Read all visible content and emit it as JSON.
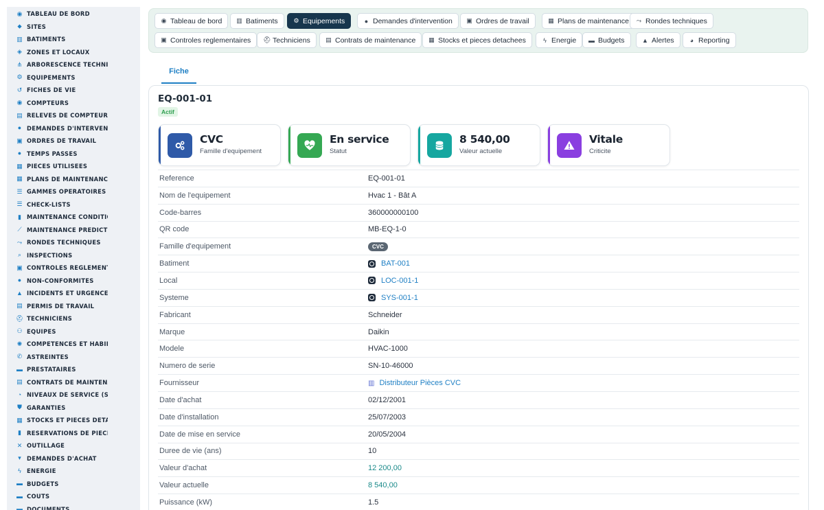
{
  "sidebar": {
    "items": [
      {
        "label": "TABLEAU DE BORD",
        "icon": "gauge-icon",
        "glyph": "◉"
      },
      {
        "label": "SITES",
        "icon": "map-pin-icon",
        "glyph": "⬥"
      },
      {
        "label": "BATIMENTS",
        "icon": "building-icon",
        "glyph": "▥"
      },
      {
        "label": "ZONES ET LOCAUX",
        "icon": "layers-icon",
        "glyph": "◈"
      },
      {
        "label": "ARBORESCENCE TECHNI",
        "icon": "tree-icon",
        "glyph": "⋔"
      },
      {
        "label": "EQUIPEMENTS",
        "icon": "gears-icon",
        "glyph": "⚙"
      },
      {
        "label": "FICHES DE VIE",
        "icon": "history-icon",
        "glyph": "↺"
      },
      {
        "label": "COMPTEURS",
        "icon": "gauge-icon",
        "glyph": "◉"
      },
      {
        "label": "RELEVES DE COMPTEURS",
        "icon": "chart-icon",
        "glyph": "▤"
      },
      {
        "label": "DEMANDES D'INTERVENT",
        "icon": "question-icon",
        "glyph": "●"
      },
      {
        "label": "ORDRES DE TRAVAIL",
        "icon": "clipboard-icon",
        "glyph": "▣"
      },
      {
        "label": "TEMPS PASSES",
        "icon": "clock-icon",
        "glyph": "●"
      },
      {
        "label": "PIECES UTILISEES",
        "icon": "boxes-icon",
        "glyph": "▦"
      },
      {
        "label": "PLANS DE MAINTENANCE",
        "icon": "calendar-icon",
        "glyph": "▦"
      },
      {
        "label": "GAMMES OPERATOIRES",
        "icon": "list-icon",
        "glyph": "☰"
      },
      {
        "label": "CHECK-LISTS",
        "icon": "checklist-icon",
        "glyph": "☰"
      },
      {
        "label": "MAINTENANCE CONDITIO",
        "icon": "thermometer-icon",
        "glyph": "▮"
      },
      {
        "label": "MAINTENANCE PREDICTI",
        "icon": "chart-line-icon",
        "glyph": "⟋"
      },
      {
        "label": "RONDES TECHNIQUES",
        "icon": "route-icon",
        "glyph": "⤳"
      },
      {
        "label": "INSPECTIONS",
        "icon": "search-icon",
        "glyph": "⌕"
      },
      {
        "label": "CONTROLES REGLEMENT",
        "icon": "clipboard-check-icon",
        "glyph": "▣"
      },
      {
        "label": "NON-CONFORMITES",
        "icon": "alert-circle-icon",
        "glyph": "●"
      },
      {
        "label": "INCIDENTS ET URGENCES",
        "icon": "warning-icon",
        "glyph": "▲"
      },
      {
        "label": "PERMIS DE TRAVAIL",
        "icon": "file-icon",
        "glyph": "▤"
      },
      {
        "label": "TECHNICIENS",
        "icon": "hard-hat-icon",
        "glyph": "⛑"
      },
      {
        "label": "EQUIPES",
        "icon": "users-icon",
        "glyph": "⚇"
      },
      {
        "label": "COMPETENCES ET HABIL",
        "icon": "certificate-icon",
        "glyph": "✺"
      },
      {
        "label": "ASTREINTES",
        "icon": "phone-icon",
        "glyph": "✆"
      },
      {
        "label": "PRESTATAIRES",
        "icon": "handshake-icon",
        "glyph": "▬"
      },
      {
        "label": "CONTRATS DE MAINTENA",
        "icon": "contract-icon",
        "glyph": "▤"
      },
      {
        "label": "NIVEAUX DE SERVICE (SL",
        "icon": "stopwatch-icon",
        "glyph": "◔"
      },
      {
        "label": "GARANTIES",
        "icon": "shield-icon",
        "glyph": "⛊"
      },
      {
        "label": "STOCKS ET PIECES DETA",
        "icon": "boxes-icon",
        "glyph": "▦"
      },
      {
        "label": "RESERVATIONS DE PIECE",
        "icon": "bookmark-icon",
        "glyph": "▮"
      },
      {
        "label": "OUTILLAGE",
        "icon": "tools-icon",
        "glyph": "✕"
      },
      {
        "label": "DEMANDES D'ACHAT",
        "icon": "cart-icon",
        "glyph": "▾"
      },
      {
        "label": "ENERGIE",
        "icon": "bolt-icon",
        "glyph": "ϟ"
      },
      {
        "label": "BUDGETS",
        "icon": "wallet-icon",
        "glyph": "▬"
      },
      {
        "label": "COUTS",
        "icon": "coins-icon",
        "glyph": "▬"
      },
      {
        "label": "DOCUMENTS",
        "icon": "folder-icon",
        "glyph": "▬"
      }
    ]
  },
  "topnav": {
    "row1": [
      {
        "label": "Tableau de bord",
        "icon": "gauge-icon",
        "glyph": "◉",
        "active": false
      },
      {
        "label": "Batiments",
        "icon": "building-icon",
        "glyph": "▥",
        "active": false
      },
      {
        "label": "Equipements",
        "icon": "gears-icon",
        "glyph": "⚙",
        "active": true
      },
      {
        "label": "Demandes d'intervention",
        "icon": "question-icon",
        "glyph": "●",
        "active": false
      },
      {
        "label": "Ordres de travail",
        "icon": "clipboard-icon",
        "glyph": "▣",
        "active": false
      },
      {
        "label": "Plans de maintenance",
        "icon": "calendar-icon",
        "glyph": "▦",
        "active": false
      },
      {
        "label": "Rondes techniques",
        "icon": "route-icon",
        "glyph": "⤳",
        "active": false
      }
    ],
    "row2": [
      {
        "label": "Controles reglementaires",
        "icon": "clipboard-check-icon",
        "glyph": "▣",
        "active": false
      },
      {
        "label": "Techniciens",
        "icon": "hard-hat-icon",
        "glyph": "⛑",
        "active": false
      },
      {
        "label": "Contrats de maintenance",
        "icon": "contract-icon",
        "glyph": "▤",
        "active": false
      },
      {
        "label": "Stocks et pieces detachees",
        "icon": "boxes-icon",
        "glyph": "▦",
        "active": false
      },
      {
        "label": "Energie",
        "icon": "bolt-icon",
        "glyph": "ϟ",
        "active": false
      },
      {
        "label": "Budgets",
        "icon": "wallet-icon",
        "glyph": "▬",
        "active": false
      },
      {
        "label": "Alertes",
        "icon": "bell-icon",
        "glyph": "▲",
        "active": false
      },
      {
        "label": "Reporting",
        "icon": "pie-chart-icon",
        "glyph": "◕",
        "active": false
      }
    ]
  },
  "tabs": {
    "fiche": "Fiche"
  },
  "equipment": {
    "code": "EQ-001-01",
    "status_badge": "Actif"
  },
  "kpis": [
    {
      "value": "CVC",
      "label": "Famille d'equipement",
      "icon": "gears-icon",
      "color": "#2f5aa8",
      "bar": "#2f5aa8"
    },
    {
      "value": "En service",
      "label": "Statut",
      "icon": "heart-pulse-icon",
      "color": "#35a853",
      "bar": "#35a853"
    },
    {
      "value": "8 540,00",
      "label": "Valeur actuelle",
      "icon": "coins-icon",
      "color": "#16a7a0",
      "bar": "#16a7a0"
    },
    {
      "value": "Vitale",
      "label": "Criticite",
      "icon": "warning-icon",
      "color": "#8a3fe0",
      "bar": "#8a3fe0"
    }
  ],
  "details": [
    {
      "key": "Reference",
      "value": "EQ-001-01",
      "type": "text"
    },
    {
      "key": "Nom de l'equipement",
      "value": "Hvac 1 - Bât A",
      "type": "text"
    },
    {
      "key": "Code-barres",
      "value": "360000000100",
      "type": "text"
    },
    {
      "key": "QR code",
      "value": "MB-EQ-1-0",
      "type": "text"
    },
    {
      "key": "Famille d'equipement",
      "value": "CVC",
      "type": "pill"
    },
    {
      "key": "Batiment",
      "value": "BAT-001",
      "type": "ref"
    },
    {
      "key": "Local",
      "value": "LOC-001-1",
      "type": "ref"
    },
    {
      "key": "Systeme",
      "value": "SYS-001-1",
      "type": "ref"
    },
    {
      "key": "Fabricant",
      "value": "Schneider",
      "type": "text"
    },
    {
      "key": "Marque",
      "value": "Daikin",
      "type": "text"
    },
    {
      "key": "Modele",
      "value": "HVAC-1000",
      "type": "text"
    },
    {
      "key": "Numero de serie",
      "value": "SN-10-46000",
      "type": "text"
    },
    {
      "key": "Fournisseur",
      "value": "Distributeur Pièces CVC",
      "type": "supplier"
    },
    {
      "key": "Date d'achat",
      "value": "02/12/2001",
      "type": "text"
    },
    {
      "key": "Date d'installation",
      "value": "25/07/2003",
      "type": "text"
    },
    {
      "key": "Date de mise en service",
      "value": "20/05/2004",
      "type": "text"
    },
    {
      "key": "Duree de vie (ans)",
      "value": "10",
      "type": "text"
    },
    {
      "key": "Valeur d'achat",
      "value": "12 200,00",
      "type": "money"
    },
    {
      "key": "Valeur actuelle",
      "value": "8 540,00",
      "type": "money"
    },
    {
      "key": "Puissance (kW)",
      "value": "1.5",
      "type": "text"
    }
  ]
}
